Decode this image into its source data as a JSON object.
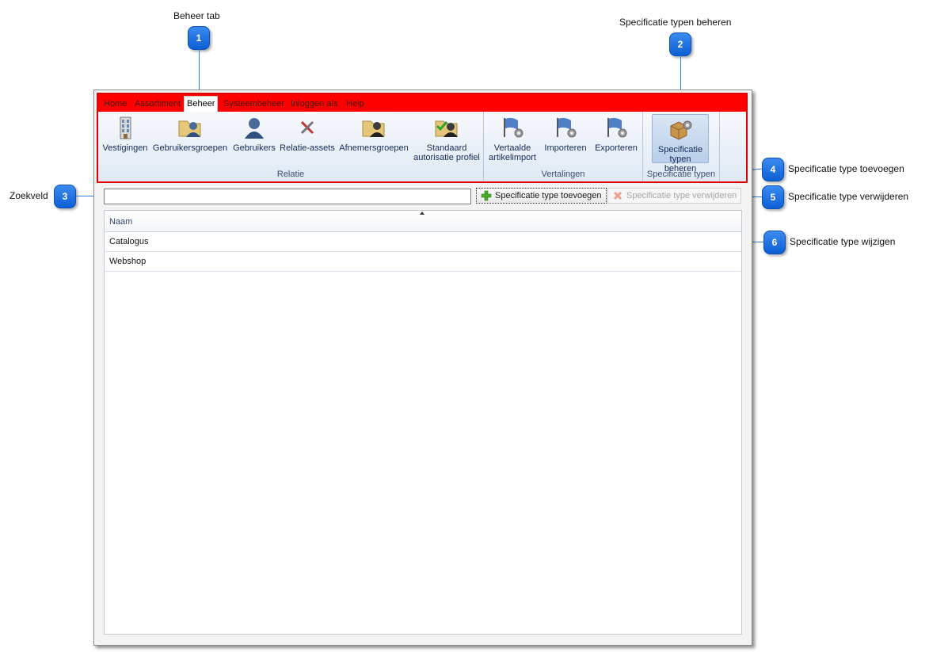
{
  "callouts": [
    {
      "num": "1",
      "label": "Beheer tab"
    },
    {
      "num": "2",
      "label": "Specificatie typen beheren"
    },
    {
      "num": "3",
      "label": "Zoekveld"
    },
    {
      "num": "4",
      "label": "Specificatie type toevoegen"
    },
    {
      "num": "5",
      "label": "Specificatie type verwijderen"
    },
    {
      "num": "6",
      "label": "Specificatie type wijzigen"
    }
  ],
  "tabs": [
    "Home",
    "Assortiment",
    "Beheer",
    "Systeembeheer",
    "Inloggen als",
    "Help"
  ],
  "active_tab": "Beheer",
  "groups": {
    "relatie": {
      "label": "Relatie",
      "buttons": [
        "Vestigingen",
        "Gebruikersgroepen",
        "Gebruikers",
        "Relatie-assets",
        "Afnemersgroepen",
        "Standaard",
        "autorisatie profiel"
      ]
    },
    "vertalingen": {
      "label": "Vertalingen",
      "buttons": [
        "Vertaalde",
        "artikelimport",
        "Importeren",
        "Exporteren"
      ]
    },
    "specificatie": {
      "label": "Specificatie typen",
      "buttons": [
        "Specificatie",
        "typen beheren"
      ]
    }
  },
  "search": {
    "value": ""
  },
  "toolbar": {
    "add_label": "Specificatie type toevoegen",
    "delete_label": "Specificatie type verwijderen"
  },
  "grid": {
    "column": "Naam",
    "rows": [
      "Catalogus",
      "Webshop"
    ]
  },
  "colors": {
    "tabbar": "#ff0000",
    "badge": "#1a73e8",
    "accent_line": "#2f7fe0"
  }
}
